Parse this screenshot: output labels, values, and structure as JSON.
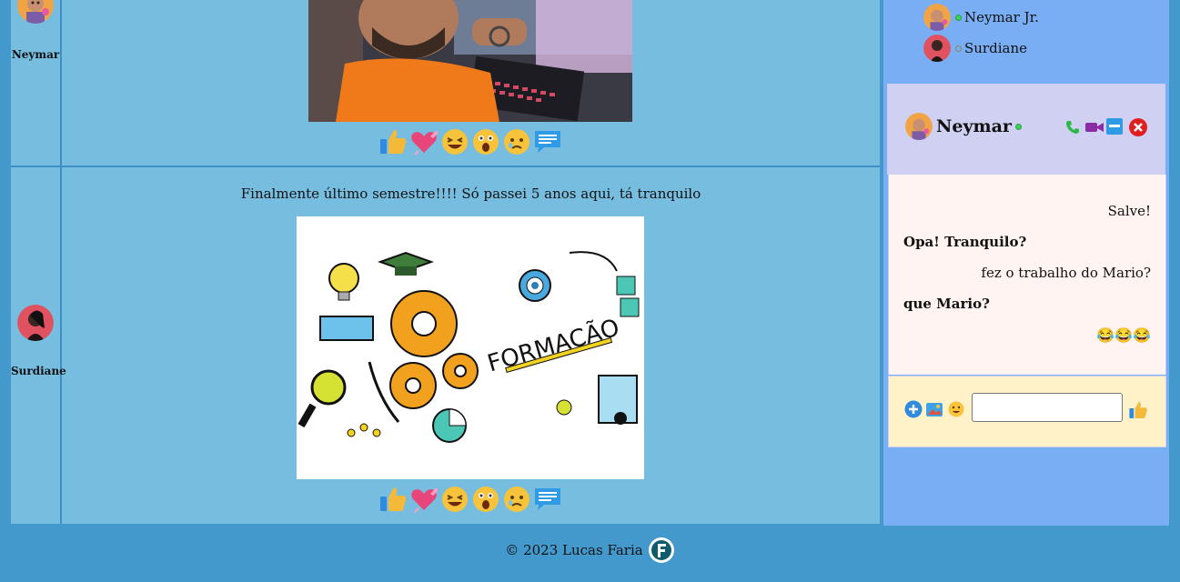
{
  "posts": [
    {
      "author": "Neymar",
      "caption": ""
    },
    {
      "author": "Surdiane",
      "caption": "Finalmente último semestre!!!! Só passei 5 anos aqui, tá tranquilo"
    }
  ],
  "photo2_text": "FORMAÇÃO",
  "online": [
    {
      "name": "Neymar Jr.",
      "status": "online"
    },
    {
      "name": "Surdiane",
      "status": "offline"
    }
  ],
  "chat": {
    "contact": "Neymar",
    "messages": [
      {
        "text": "Salve!",
        "dir": "out"
      },
      {
        "text": "Opa! Tranquilo?",
        "dir": "in"
      },
      {
        "text": "fez o trabalho do Mario?",
        "dir": "out"
      },
      {
        "text": "que Mario?",
        "dir": "in"
      },
      {
        "text": "😂😂😂",
        "dir": "out"
      }
    ],
    "input_value": ""
  },
  "footer": {
    "text": "© 2023 Lucas Faria"
  },
  "colors": {
    "page_bg": "#4499cc",
    "post_bg": "#76bde0",
    "sidebar_bg": "#79aef5",
    "chat_head": "#cfd0f2",
    "chat_body": "#fff4f1",
    "chat_foot": "#fff2c8"
  }
}
